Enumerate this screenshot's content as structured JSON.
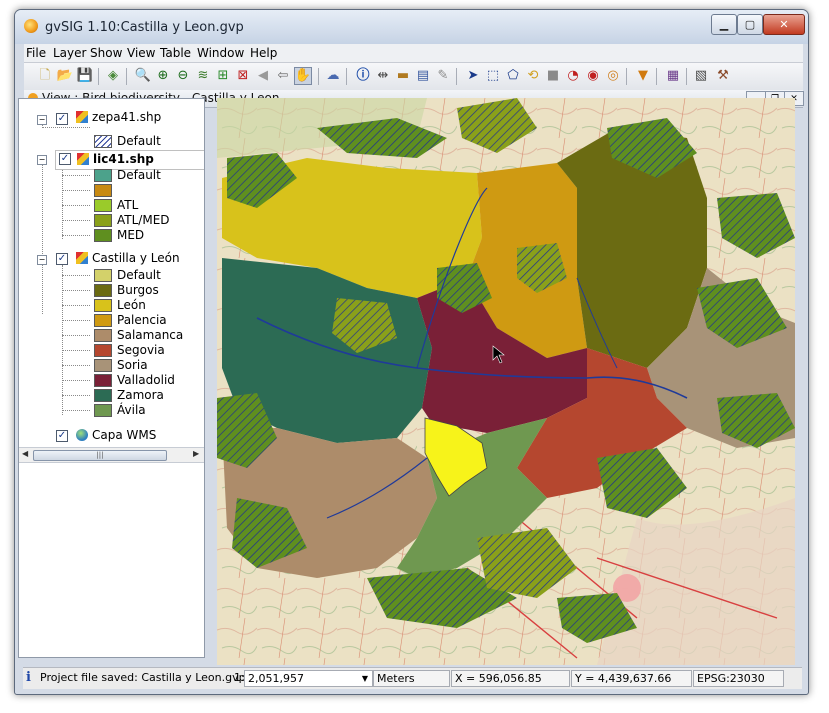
{
  "window": {
    "title": "gvSIG 1.10:Castilla y Leon.gvp"
  },
  "menu": [
    "File",
    "Layer",
    "Show",
    "View",
    "Table",
    "Window",
    "Help"
  ],
  "view": {
    "title": "View : Bird biodiversity - Castilla y Leon"
  },
  "toc": {
    "layers": [
      {
        "name": "zepa41.shp",
        "checked": true,
        "legend": [
          {
            "label": "Default",
            "color": "#ffffff",
            "hatch": true
          }
        ]
      },
      {
        "name": "lic41.shp",
        "checked": true,
        "legend": [
          {
            "label": "Default",
            "color": "#4ca28b"
          },
          {
            "label": "",
            "color": "#c88a12"
          },
          {
            "label": "ATL",
            "color": "#9acb2a"
          },
          {
            "label": "ATL/MED",
            "color": "#8aa01a"
          },
          {
            "label": "MED",
            "color": "#5f8f1f"
          }
        ]
      },
      {
        "name": "Castilla y León",
        "checked": true,
        "legend": [
          {
            "label": "Default",
            "color": "#d3d16a"
          },
          {
            "label": "Burgos",
            "color": "#6b6b12"
          },
          {
            "label": "León",
            "color": "#d8c21b"
          },
          {
            "label": "Palencia",
            "color": "#cf9a12"
          },
          {
            "label": "Salamanca",
            "color": "#ad8c6a"
          },
          {
            "label": "Segovia",
            "color": "#b5472f"
          },
          {
            "label": "Soria",
            "color": "#a89378"
          },
          {
            "label": "Valladolid",
            "color": "#7a2037"
          },
          {
            "label": "Zamora",
            "color": "#2c6b54"
          },
          {
            "label": "Ávila",
            "color": "#6f9850"
          }
        ]
      },
      {
        "name": "Capa WMS",
        "checked": true,
        "legend": []
      }
    ]
  },
  "status": {
    "message": "Project file saved: Castilla y Leon.gvp",
    "scale_prefix": "1:",
    "scale": "2,051,957",
    "units": "Meters",
    "x": "X = 596,056.85",
    "y": "Y = 4,439,637.66",
    "epsg": "EPSG:23030"
  }
}
